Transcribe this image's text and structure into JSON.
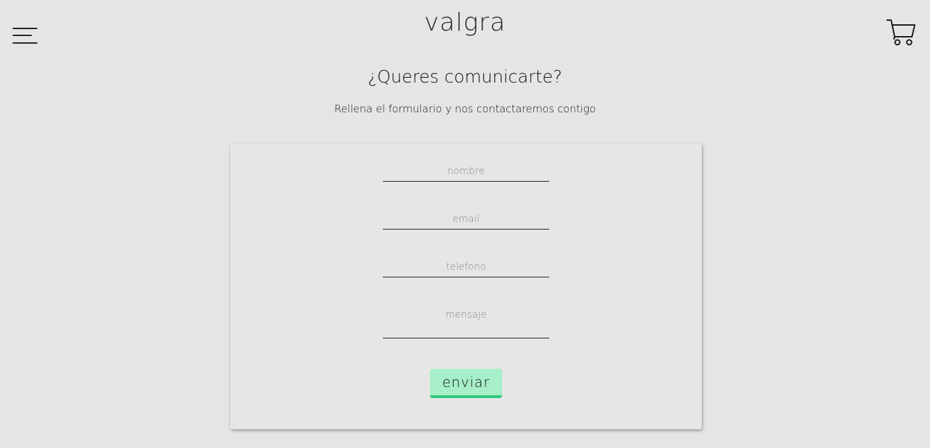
{
  "header": {
    "logo": "valgra",
    "menu_icon": "hamburger-menu-icon",
    "cart_icon": "shopping-cart-icon"
  },
  "main": {
    "title": "¿Queres comunicarte?",
    "subtitle": "Rellena el formulario y nos contactaremos contigo"
  },
  "form": {
    "nombre_placeholder": "nombre",
    "email_placeholder": "email",
    "telefono_placeholder": "telefono",
    "mensaje_placeholder": "mensaje",
    "submit_label": "enviar"
  },
  "colors": {
    "background": "#e5e5e5",
    "button_fill": "#a6efc9",
    "button_border": "#2fc77e"
  }
}
